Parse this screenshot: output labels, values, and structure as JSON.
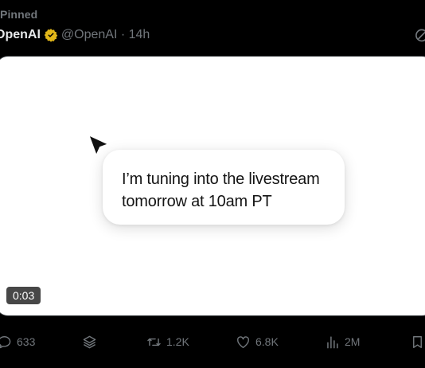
{
  "tweet": {
    "pinned_label": "Pinned",
    "author": {
      "name": "OpenAI",
      "handle_time": "@OpenAI · 14h",
      "verified_color": "#e2b719"
    },
    "media": {
      "bubble_text": "I’m tuning into the livestream tomorrow at 10am PT",
      "duration": "0:03"
    },
    "actions": {
      "replies": "633",
      "retweets": "1.2K",
      "likes": "6.8K",
      "views": "2M"
    }
  },
  "colors": {
    "background": "#000000",
    "text_primary": "#e7e9ea",
    "text_secondary": "#71767b",
    "media_background": "#ffffff"
  },
  "icons": [
    "reply-icon",
    "stack-icon",
    "retweet-icon",
    "like-icon",
    "views-icon",
    "bookmark-icon",
    "grok-icon",
    "cursor-icon",
    "verified-badge-icon"
  ]
}
